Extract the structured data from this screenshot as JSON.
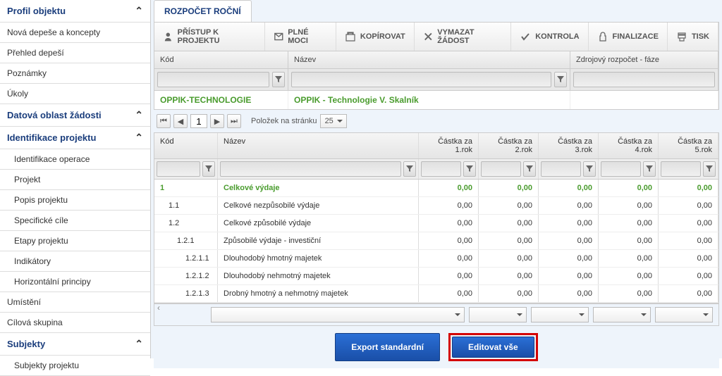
{
  "sidebar": {
    "profile": "Profil objektu",
    "items1": [
      "Nová depeše a koncepty",
      "Přehled depeší",
      "Poznámky",
      "Úkoly"
    ],
    "dataArea": "Datová oblast žádosti",
    "identProj": "Identifikace projektu",
    "items2": [
      "Identifikace operace",
      "Projekt",
      "Popis projektu",
      "Specifické cíle",
      "Etapy projektu",
      "Indikátory",
      "Horizontální principy"
    ],
    "items3": [
      "Umístění",
      "Cílová skupina"
    ],
    "subjects": "Subjekty",
    "items4": [
      "Subjekty projektu"
    ]
  },
  "tab": "ROZPOČET ROČNÍ",
  "toolbar": [
    "PŘÍSTUP K PROJEKTU",
    "PLNÉ MOCI",
    "KOPÍROVAT",
    "VYMAZAT ŽÁDOST",
    "KONTROLA",
    "FINALIZACE",
    "TISK"
  ],
  "topGrid": {
    "headers": [
      "Kód",
      "Název",
      "Zdrojový rozpočet - fáze"
    ],
    "row": [
      "OPPIK-TECHNOLOGIE",
      "OPPIK - Technologie V. Skalník",
      ""
    ]
  },
  "pager": {
    "page": "1",
    "label": "Položek na stránku",
    "size": "25"
  },
  "grid": {
    "headers": [
      "Kód",
      "Název",
      "Částka za 1.rok",
      "Částka za 2.rok",
      "Částka za 3.rok",
      "Částka za 4.rok",
      "Částka za 5.rok"
    ],
    "rows": [
      {
        "hl": true,
        "c": [
          "1",
          "Celkové výdaje",
          "0,00",
          "0,00",
          "0,00",
          "0,00",
          "0,00"
        ]
      },
      {
        "hl": false,
        "c": [
          "1.1",
          "Celkové nezpůsobilé výdaje",
          "0,00",
          "0,00",
          "0,00",
          "0,00",
          "0,00"
        ]
      },
      {
        "hl": false,
        "c": [
          "1.2",
          "Celkové způsobilé výdaje",
          "0,00",
          "0,00",
          "0,00",
          "0,00",
          "0,00"
        ]
      },
      {
        "hl": false,
        "c": [
          "1.2.1",
          "Způsobilé výdaje - investiční",
          "0,00",
          "0,00",
          "0,00",
          "0,00",
          "0,00"
        ]
      },
      {
        "hl": false,
        "c": [
          "1.2.1.1",
          "Dlouhodobý hmotný majetek",
          "0,00",
          "0,00",
          "0,00",
          "0,00",
          "0,00"
        ]
      },
      {
        "hl": false,
        "c": [
          "1.2.1.2",
          "Dlouhodobý nehmotný majetek",
          "0,00",
          "0,00",
          "0,00",
          "0,00",
          "0,00"
        ]
      },
      {
        "hl": false,
        "c": [
          "1.2.1.3",
          "Drobný hmotný a nehmotný majetek",
          "0,00",
          "0,00",
          "0,00",
          "0,00",
          "0,00"
        ]
      }
    ]
  },
  "actions": {
    "export": "Export standardní",
    "edit": "Editovat vše"
  }
}
